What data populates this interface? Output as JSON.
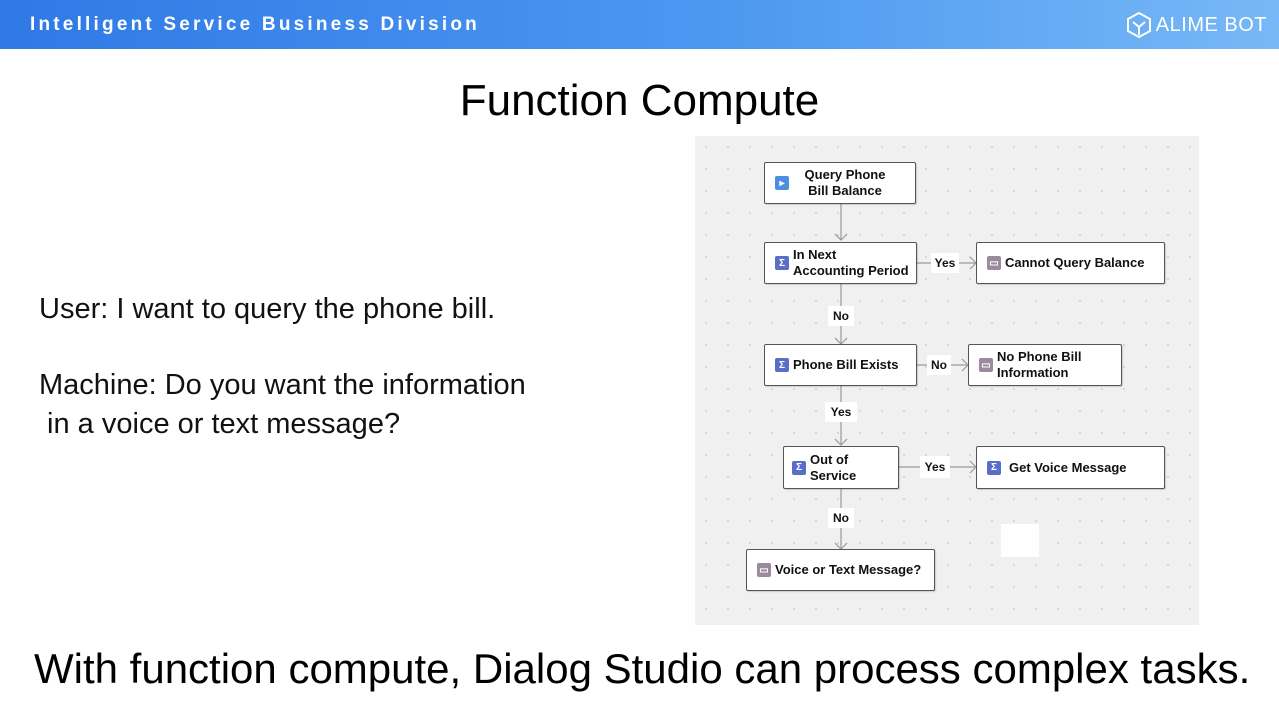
{
  "header": {
    "division": "Intelligent Service Business Division",
    "logo_text": "ALIME BOT",
    "logo_icon": "bot-hexagon-icon"
  },
  "slide": {
    "title": "Function Compute",
    "user_line": "User: I want to query the phone bill.",
    "machine_line_1": "Machine: Do you want the information",
    "machine_line_2": " in a voice or text message?",
    "footer": "With function compute, Dialog Studio can process complex tasks."
  },
  "flowchart": {
    "nodes": {
      "query": "Query Phone Bill Balance",
      "accounting": "In Next Accounting Period",
      "cannot_query": "Cannot Query Balance",
      "bill_exists": "Phone Bill Exists",
      "no_bill": "No Phone Bill Information",
      "out_of_service": "Out of Service",
      "voice_message": "Get Voice Message",
      "voice_or_text": "Voice or Text Message?"
    },
    "edges": {
      "accounting_yes": "Yes",
      "accounting_no": "No",
      "exists_no": "No",
      "exists_yes": "Yes",
      "service_yes": "Yes",
      "service_no": "No"
    }
  }
}
